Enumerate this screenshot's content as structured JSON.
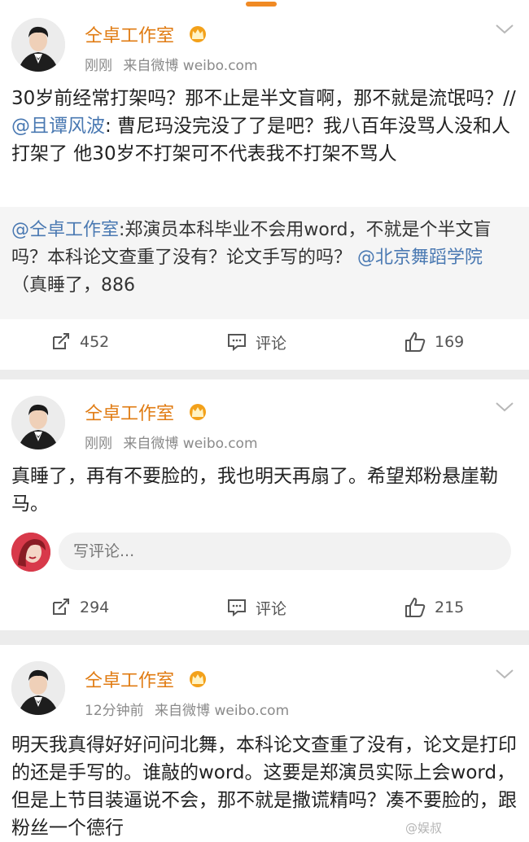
{
  "posts": [
    {
      "username": "仝卓工作室",
      "time": "刚刚",
      "source": "来自微博 weibo.com",
      "text_pre": "30岁前经常打架吗？那不止是半文盲啊，那不就是流氓吗？//",
      "mention": "@且谭风波",
      "text_post": ": 曹尼玛没完没了了是吧？我八百年没骂人没和人打架了 他30岁不打架可不代表我不打架不骂人",
      "quote": {
        "mention1": "@仝卓工作室",
        "text1": ":郑演员本科毕业不会用word，不就是个半文盲吗？本科论文查重了没有？论文手写的吗？",
        "mention2": "@北京舞蹈学院",
        "text2": "（真睡了，886"
      },
      "reposts": "452",
      "comments": "评论",
      "likes": "169"
    },
    {
      "username": "仝卓工作室",
      "time": "刚刚",
      "source": "来自微博 weibo.com",
      "text": "真睡了，再有不要脸的，我也明天再扇了。希望郑粉悬崖勒马。",
      "comment_placeholder": "写评论...",
      "reposts": "294",
      "comments": "评论",
      "likes": "215"
    },
    {
      "username": "仝卓工作室",
      "time": "12分钟前",
      "source": "来自微博 weibo.com",
      "text": "明天我真得好好问问北舞，本科论文查重了没有，论文是打印的还是手写的。谁敲的word。这要是郑演员实际上会word，但是上节目装逼说不会，那不就是撒谎精吗？凑不要脸的，跟粉丝一个德行"
    }
  ],
  "watermark": "@娱叔",
  "icons": [
    "avatar",
    "crown-badge-icon",
    "chevron-down-icon",
    "repost-icon",
    "comment-icon",
    "like-icon"
  ],
  "colors": {
    "username": "#e07b12",
    "mention": "#4a79b2",
    "meta": "#8a8a8a",
    "separator": "#ececec"
  }
}
